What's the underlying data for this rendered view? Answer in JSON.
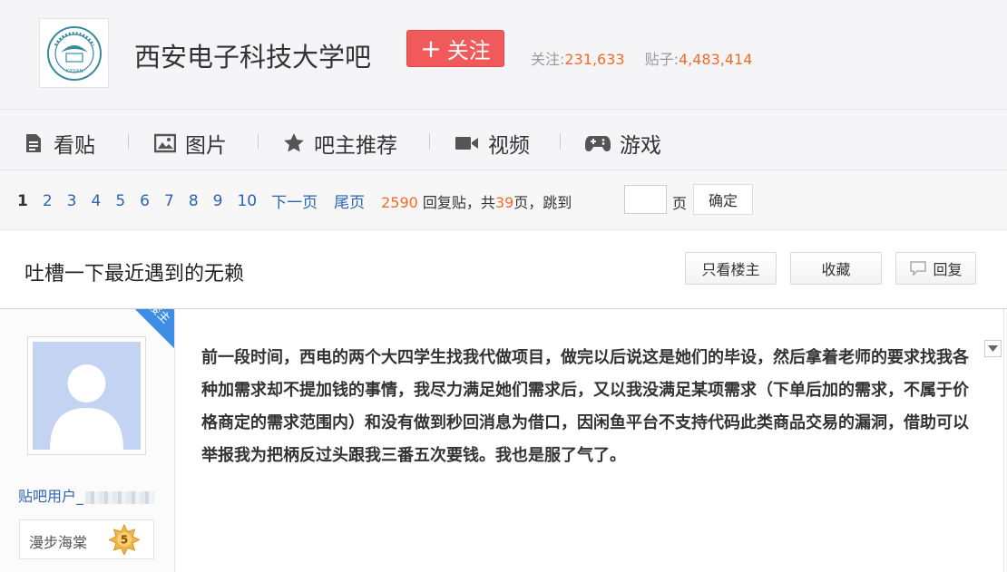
{
  "header": {
    "forum_name": "西安电子科技大学吧",
    "follow_label": "关注",
    "follow_plus": "+",
    "followers_label": "关注:",
    "followers_count": "231,633",
    "posts_label": "贴子:",
    "posts_count": "4,483,414",
    "logo_text": "XIDIAN"
  },
  "nav": [
    {
      "label": "看贴",
      "icon": "document-icon"
    },
    {
      "label": "图片",
      "icon": "image-icon"
    },
    {
      "label": "吧主推荐",
      "icon": "star-icon"
    },
    {
      "label": "视频",
      "icon": "video-icon"
    },
    {
      "label": "游戏",
      "icon": "gamepad-icon"
    }
  ],
  "pager": {
    "pages": [
      "1",
      "2",
      "3",
      "4",
      "5",
      "6",
      "7",
      "8",
      "9",
      "10"
    ],
    "next": "下一页",
    "last": "尾页",
    "reply_count": "2590",
    "reply_text": "回复贴，共",
    "page_total": "39",
    "page_text": "页，跳到",
    "page_unit": "页",
    "confirm": "确定"
  },
  "thread": {
    "title": "吐槽一下最近遇到的无赖",
    "only_op": "只看楼主",
    "favorite": "收藏",
    "reply": "回复"
  },
  "post": {
    "badge": "楼主",
    "username": "贴吧用户_",
    "level_name": "漫步海棠",
    "level": "5",
    "content": "前一段时间，西电的两个大四学生找我代做项目，做完以后说这是她们的毕设，然后拿着老师的要求找我各种加需求却不提加钱的事情，我尽力满足她们需求后，又以我没满足某项需求（下单后加的需求，不属于价格商定的需求范围内）和没有做到秒回消息为借口，因闲鱼平台不支持代码此类商品交易的漏洞，借助可以举报我为把柄反过头跟我三番五次要钱。我也是服了气了。"
  },
  "colors": {
    "follow_red": "#f05a5a",
    "link_blue": "#2d64b3",
    "stat_orange": "#f36b27",
    "badge_blue": "#3e8ee5"
  }
}
